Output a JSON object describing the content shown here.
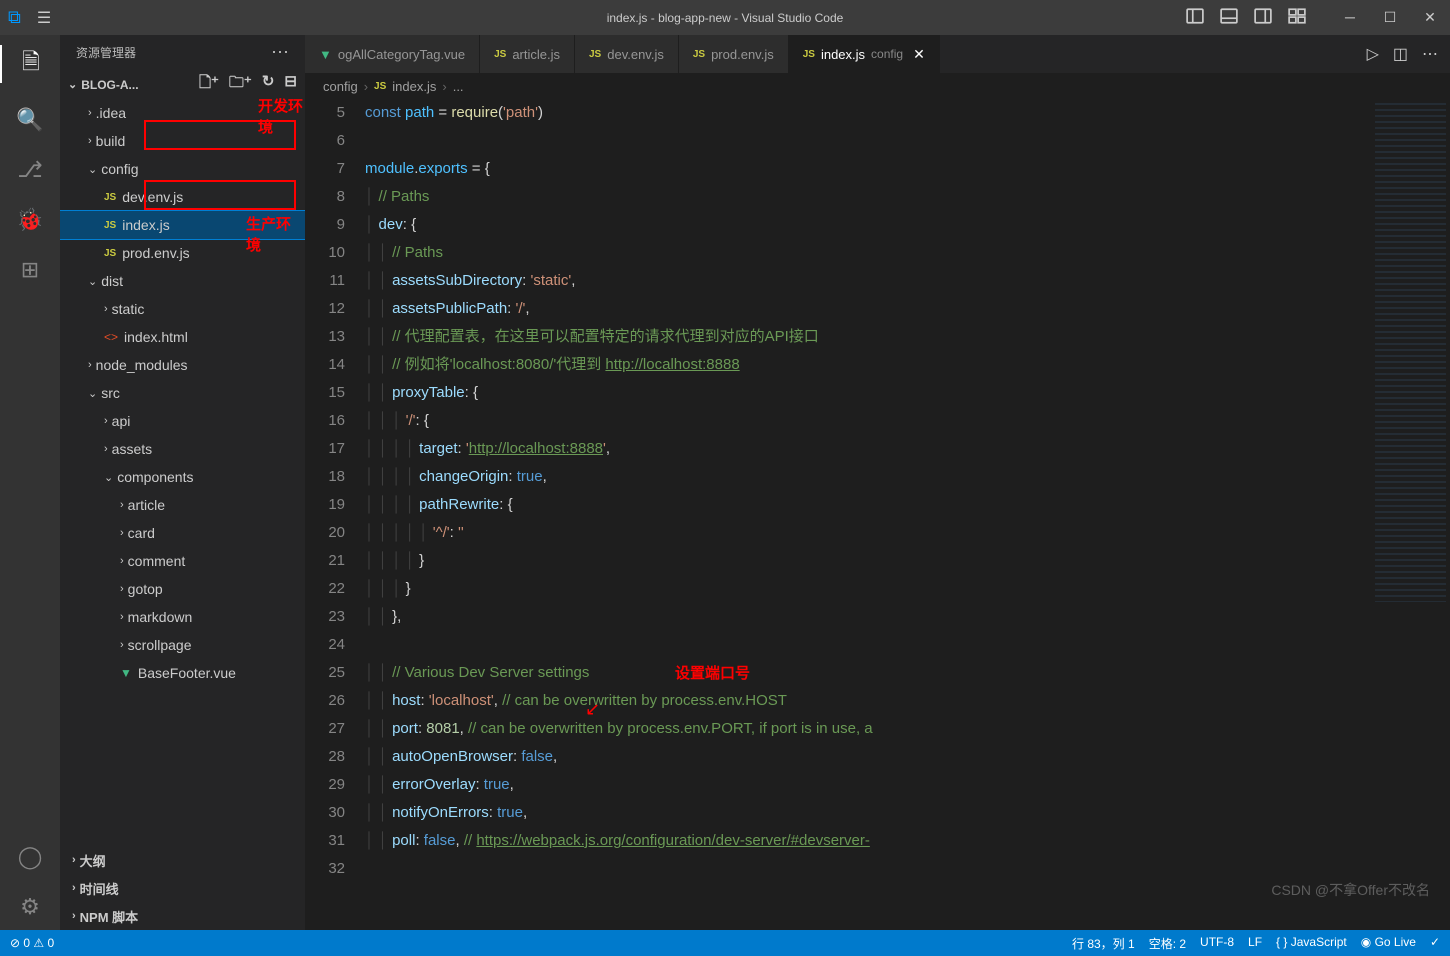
{
  "titlebar": {
    "title": "index.js - blog-app-new - Visual Studio Code"
  },
  "sidebar": {
    "header_title": "资源管理器",
    "project_name": "BLOG-A...",
    "tree": [
      {
        "type": "folder",
        "name": ".idea",
        "depth": 1,
        "expanded": false
      },
      {
        "type": "folder",
        "name": "build",
        "depth": 1,
        "expanded": false
      },
      {
        "type": "folder",
        "name": "config",
        "depth": 1,
        "expanded": true
      },
      {
        "type": "file",
        "name": "dev.env.js",
        "depth": 2,
        "icon": "js"
      },
      {
        "type": "file",
        "name": "index.js",
        "depth": 2,
        "icon": "js",
        "selected": true
      },
      {
        "type": "file",
        "name": "prod.env.js",
        "depth": 2,
        "icon": "js"
      },
      {
        "type": "folder",
        "name": "dist",
        "depth": 1,
        "expanded": true
      },
      {
        "type": "folder",
        "name": "static",
        "depth": 2,
        "expanded": false
      },
      {
        "type": "file",
        "name": "index.html",
        "depth": 2,
        "icon": "html"
      },
      {
        "type": "folder",
        "name": "node_modules",
        "depth": 1,
        "expanded": false
      },
      {
        "type": "folder",
        "name": "src",
        "depth": 1,
        "expanded": true
      },
      {
        "type": "folder",
        "name": "api",
        "depth": 2,
        "expanded": false
      },
      {
        "type": "folder",
        "name": "assets",
        "depth": 2,
        "expanded": false
      },
      {
        "type": "folder",
        "name": "components",
        "depth": 2,
        "expanded": true
      },
      {
        "type": "folder",
        "name": "article",
        "depth": 3,
        "expanded": false
      },
      {
        "type": "folder",
        "name": "card",
        "depth": 3,
        "expanded": false
      },
      {
        "type": "folder",
        "name": "comment",
        "depth": 3,
        "expanded": false
      },
      {
        "type": "folder",
        "name": "gotop",
        "depth": 3,
        "expanded": false
      },
      {
        "type": "folder",
        "name": "markdown",
        "depth": 3,
        "expanded": false
      },
      {
        "type": "folder",
        "name": "scrollpage",
        "depth": 3,
        "expanded": false
      },
      {
        "type": "file",
        "name": "BaseFooter.vue",
        "depth": 3,
        "icon": "vue"
      }
    ],
    "footer_sections": [
      "大纲",
      "时间线",
      "NPM 脚本"
    ]
  },
  "annotations": {
    "dev_label": "开发环境",
    "prod_label": "生产环境",
    "port_label": "设置端口号"
  },
  "tabs": [
    {
      "label": "ogAllCategoryTag.vue",
      "icon": "vue",
      "active": false
    },
    {
      "label": "article.js",
      "icon": "js",
      "active": false
    },
    {
      "label": "dev.env.js",
      "icon": "js",
      "active": false
    },
    {
      "label": "prod.env.js",
      "icon": "js",
      "active": false
    },
    {
      "label": "index.js",
      "suffix": "config",
      "icon": "js",
      "active": true,
      "closable": true
    }
  ],
  "breadcrumb": [
    "config",
    "index.js",
    "..."
  ],
  "code": {
    "first_line": 5,
    "lines": [
      {
        "html": "<span class='c-kw'>const</span> <span class='c-var'>path</span> <span class='c-punc'>=</span> <span class='c-fn'>require</span><span class='c-punc'>(</span><span class='c-str'>'path'</span><span class='c-punc'>)</span>"
      },
      {
        "html": ""
      },
      {
        "html": "<span class='c-var'>module</span><span class='c-punc'>.</span><span class='c-var'>exports</span> <span class='c-punc'>=</span> <span class='c-punc'>{</span>"
      },
      {
        "html": "<span class='c-guide'>│ </span><span class='c-cmt'>// Paths</span>"
      },
      {
        "html": "<span class='c-guide'>│ </span><span class='c-prop'>dev</span><span class='c-punc'>:</span> <span class='c-punc'>{</span>"
      },
      {
        "html": "<span class='c-guide'>│ │ </span><span class='c-cmt'>// Paths</span>"
      },
      {
        "html": "<span class='c-guide'>│ │ </span><span class='c-prop'>assetsSubDirectory</span><span class='c-punc'>:</span> <span class='c-str'>'static'</span><span class='c-punc'>,</span>"
      },
      {
        "html": "<span class='c-guide'>│ │ </span><span class='c-prop'>assetsPublicPath</span><span class='c-punc'>:</span> <span class='c-str'>'/'</span><span class='c-punc'>,</span>"
      },
      {
        "html": "<span class='c-guide'>│ │ </span><span class='c-cmt'>// 代理配置表，在这里可以配置特定的请求代理到对应的API接口</span>"
      },
      {
        "html": "<span class='c-guide'>│ │ </span><span class='c-cmt'>// 例如将'localhost:8080/'代理到 </span><span class='c-link'>http://localhost:8888</span>"
      },
      {
        "html": "<span class='c-guide'>│ │ </span><span class='c-prop'>proxyTable</span><span class='c-punc'>:</span> <span class='c-punc'>{</span>"
      },
      {
        "html": "<span class='c-guide'>│ │ │ </span><span class='c-str'>'/'</span><span class='c-punc'>:</span> <span class='c-punc'>{</span>"
      },
      {
        "html": "<span class='c-guide'>│ │ │ │ </span><span class='c-prop'>target</span><span class='c-punc'>:</span> <span class='c-str'>'<span class='c-link' style='text-decoration:underline'>http://localhost:8888</span>'</span><span class='c-punc'>,</span>"
      },
      {
        "html": "<span class='c-guide'>│ │ │ │ </span><span class='c-prop'>changeOrigin</span><span class='c-punc'>:</span> <span class='c-bool'>true</span><span class='c-punc'>,</span>"
      },
      {
        "html": "<span class='c-guide'>│ │ │ │ </span><span class='c-prop'>pathRewrite</span><span class='c-punc'>:</span> <span class='c-punc'>{</span>"
      },
      {
        "html": "<span class='c-guide'>│ │ │ │ │ </span><span class='c-str'>'^/'</span><span class='c-punc'>:</span> <span class='c-str'>''</span>"
      },
      {
        "html": "<span class='c-guide'>│ │ │ │ </span><span class='c-punc'>}</span>"
      },
      {
        "html": "<span class='c-guide'>│ │ │ </span><span class='c-punc'>}</span>"
      },
      {
        "html": "<span class='c-guide'>│ │ </span><span class='c-punc'>},</span>"
      },
      {
        "html": ""
      },
      {
        "html": "<span class='c-guide'>│ │ </span><span class='c-cmt'>// Various Dev Server settings</span>"
      },
      {
        "html": "<span class='c-guide'>│ │ </span><span class='c-prop'>host</span><span class='c-punc'>:</span> <span class='c-str'>'localhost'</span><span class='c-punc'>,</span> <span class='c-cmt'>// can be overwritten by process.env.HOST</span>"
      },
      {
        "html": "<span class='c-guide'>│ │ </span><span class='c-prop'>port</span><span class='c-punc'>:</span> <span class='c-num'>8081</span><span class='c-punc'>,</span> <span class='c-cmt'>// can be overwritten by process.env.PORT, if port is in use, a</span>"
      },
      {
        "html": "<span class='c-guide'>│ │ </span><span class='c-prop'>autoOpenBrowser</span><span class='c-punc'>:</span> <span class='c-bool'>false</span><span class='c-punc'>,</span>"
      },
      {
        "html": "<span class='c-guide'>│ │ </span><span class='c-prop'>errorOverlay</span><span class='c-punc'>:</span> <span class='c-bool'>true</span><span class='c-punc'>,</span>"
      },
      {
        "html": "<span class='c-guide'>│ │ </span><span class='c-prop'>notifyOnErrors</span><span class='c-punc'>:</span> <span class='c-bool'>true</span><span class='c-punc'>,</span>"
      },
      {
        "html": "<span class='c-guide'>│ │ </span><span class='c-prop'>poll</span><span class='c-punc'>:</span> <span class='c-bool'>false</span><span class='c-punc'>,</span> <span class='c-cmt'>// </span><span class='c-link'>https://webpack.js.org/configuration/dev-server/#devserver-</span>"
      },
      {
        "html": ""
      }
    ]
  },
  "statusbar": {
    "left": [
      "⊘ 0 ⚠ 0"
    ],
    "right": [
      "行 83，列 1",
      "空格: 2",
      "UTF-8",
      "LF",
      "{ } JavaScript",
      "◉ Go Live",
      "✓"
    ]
  },
  "watermark": "CSDN @不拿Offer不改名"
}
